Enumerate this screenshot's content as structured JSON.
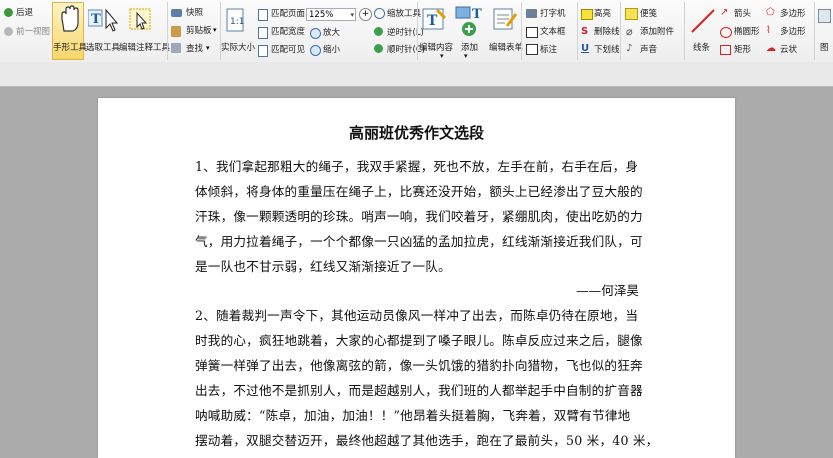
{
  "toolbar": {
    "back": "后退",
    "forward": "前一视图",
    "hand_tool": "手形工具",
    "select_tool": "选取工具",
    "annot_tool": "编辑注释工具",
    "snapshot": "快照",
    "clipboard": "剪贴板",
    "find": "查找",
    "actual_size": "实际大小",
    "fit_page": "匹配页面",
    "fit_width": "匹配宽度",
    "fit_visible": "匹配可见",
    "zoom_value": "125%",
    "zoom_tool": "缩放工具",
    "zoom_in": "放大",
    "zoom_out": "缩小",
    "rotate_left": "逆时针(L)",
    "rotate_right": "顺时针(C)",
    "edit_content": "编辑内容",
    "add": "添加",
    "edit_form": "编辑表单",
    "typewriter": "打字机",
    "textbox": "文本框",
    "callout": "标注",
    "highlight": "高亮",
    "strikeout": "删除线",
    "underline": "下划线",
    "note": "便笺",
    "attach_file": "添加附件",
    "sound": "声音",
    "line": "线条",
    "arrow": "箭头",
    "ellipse": "椭圆形",
    "rectangle": "矩形",
    "polygon": "多边形",
    "polyline": "多边形",
    "cloud": "云状",
    "more": "图"
  },
  "document": {
    "title": "高丽班优秀作文选段",
    "lines": [
      "1、我们拿起那粗大的绳子，我双手紧握，死也不放，左手在前，右手在后，身",
      "体倾斜，将身体的重量压在绳子上，比赛还没开始，额头上已经渗出了豆大般的",
      "汗珠，像一颗颗透明的珍珠。哨声一响，我们咬着牙，紧绷肌肉，使出吃奶的力",
      "气，用力拉着绳子，一个个都像一只凶猛的孟加拉虎，红线渐渐接近我们队，可",
      "是一队也不甘示弱，红线又渐渐接近了一队。"
    ],
    "author1": "——何泽昊",
    "lines2": [
      "2、随着裁判一声令下，其他运动员像风一样冲了出去，而陈卓仍待在原地，当",
      "时我的心，疯狂地跳着，大家的心都提到了嗓子眼儿。陈卓反应过来之后，腿像",
      "弹簧一样弹了出去，他像离弦的箭，像一头饥饿的猎豹扑向猎物，飞也似的狂奔",
      "出去，不过他不是抓别人，而是超越别人，我们班的人都举起手中自制的扩音器",
      "呐喊助威：“陈卓，加油，加油！！”他昂着头挺着胸，飞奔着，双臂有节律地",
      "摆动着，双腿交替迈开，最终他超越了其他选手，跑在了最前头，50 米，40 米，"
    ]
  }
}
